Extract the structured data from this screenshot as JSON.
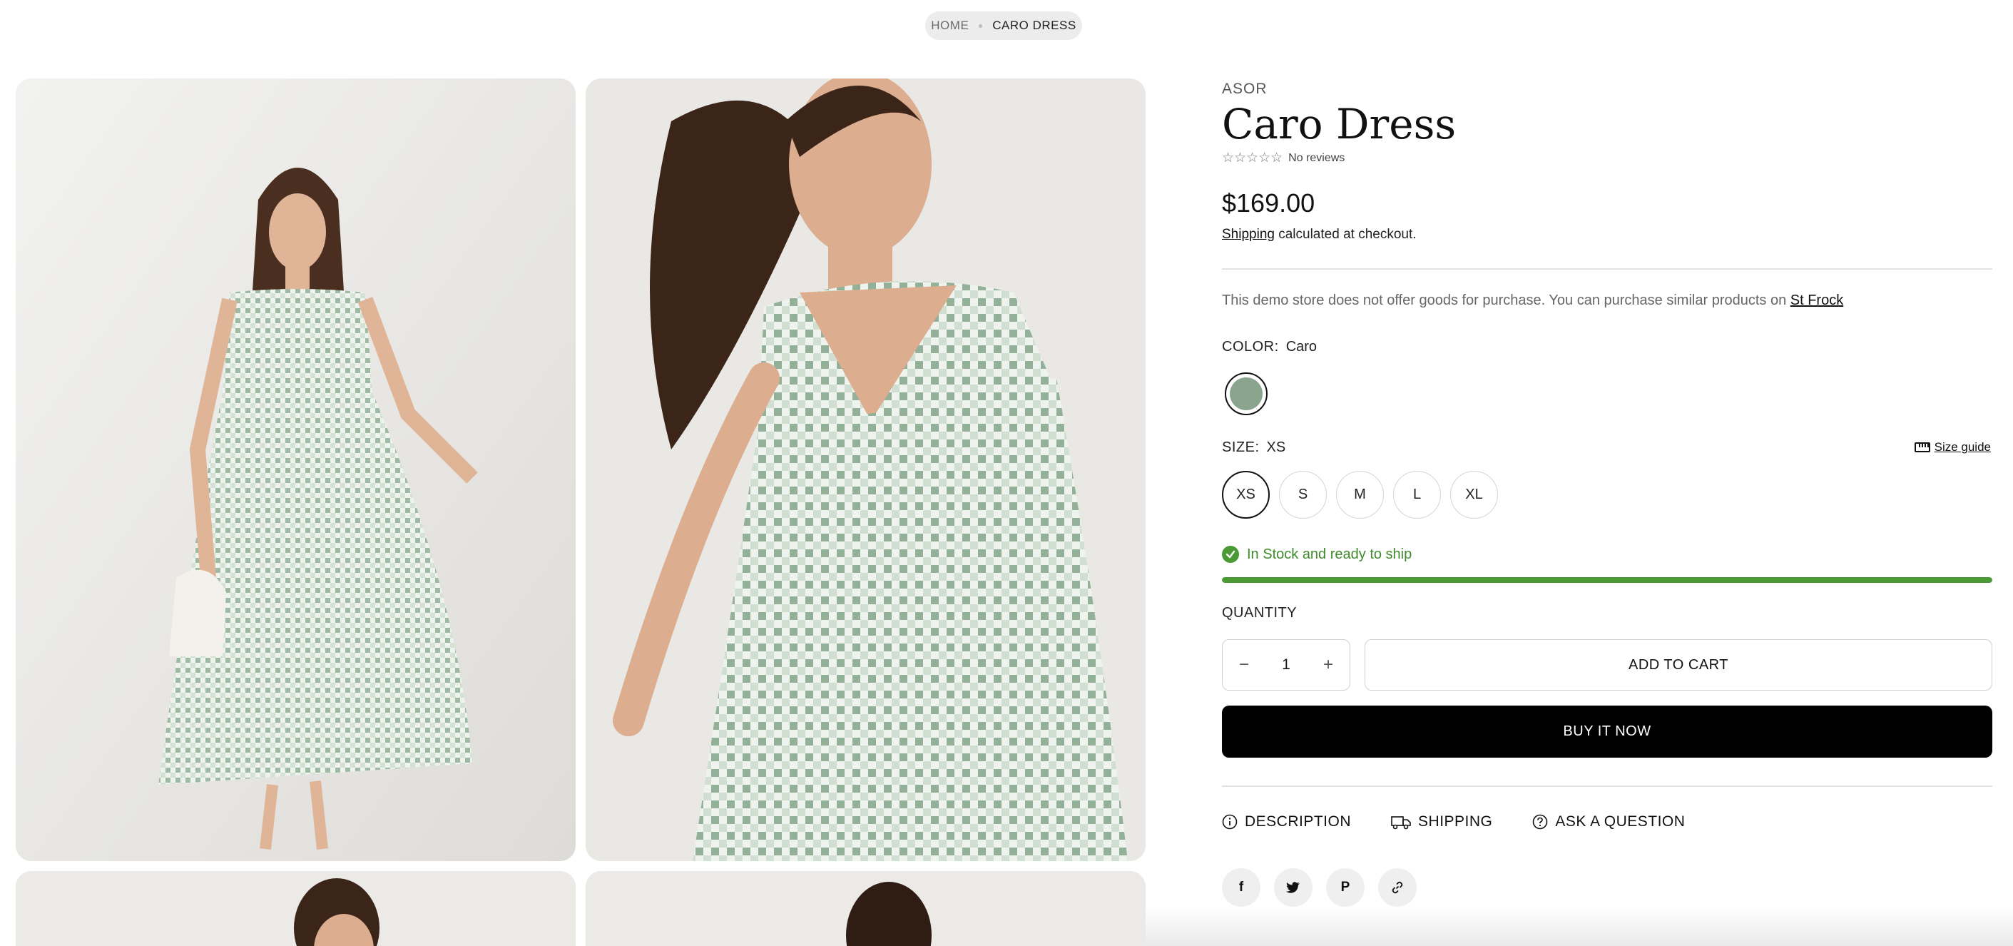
{
  "breadcrumb": {
    "home": "HOME",
    "current": "CARO DRESS"
  },
  "product": {
    "vendor": "ASOR",
    "title": "Caro Dress",
    "rating": {
      "stars": "☆☆☆☆☆",
      "reviews_text": "No reviews"
    },
    "price": "$169.00",
    "shipping_link": "Shipping",
    "shipping_rest": " calculated at checkout.",
    "demo_note": "This demo store does not offer goods for purchase. You can purchase similar products on ",
    "demo_link": "St Frock",
    "color": {
      "label": "COLOR:",
      "value": "Caro",
      "swatch": "#8aa48e"
    },
    "size": {
      "label": "SIZE:",
      "value": "XS",
      "guide": "Size guide",
      "options": [
        "XS",
        "S",
        "M",
        "L",
        "XL"
      ]
    },
    "stock": {
      "text": "In Stock and ready to ship",
      "level": 1.0,
      "color": "#4a9a36"
    },
    "quantity": {
      "label": "QUANTITY",
      "value": "1",
      "minus": "−",
      "plus": "+"
    },
    "add_to_cart": "ADD TO CART",
    "buy_now": "BUY IT NOW",
    "tabs": [
      {
        "label": "DESCRIPTION",
        "icon": "info-icon"
      },
      {
        "label": "SHIPPING",
        "icon": "truck-icon"
      },
      {
        "label": "ASK A QUESTION",
        "icon": "question-icon"
      }
    ],
    "share": [
      {
        "glyph": "f",
        "icon": "facebook-icon"
      },
      {
        "glyph": "",
        "icon": "twitter-icon"
      },
      {
        "glyph": "P",
        "icon": "pinterest-icon"
      },
      {
        "glyph": "",
        "icon": "link-icon"
      }
    ]
  },
  "gallery": {
    "images": [
      "dress-full-length",
      "dress-close-up",
      "dress-detail-1",
      "dress-detail-2"
    ]
  },
  "colors": {
    "accent": "#000000",
    "success": "#4a9a36",
    "breadcrumb_bg": "#ececec",
    "swatch": "#8aa48e"
  }
}
